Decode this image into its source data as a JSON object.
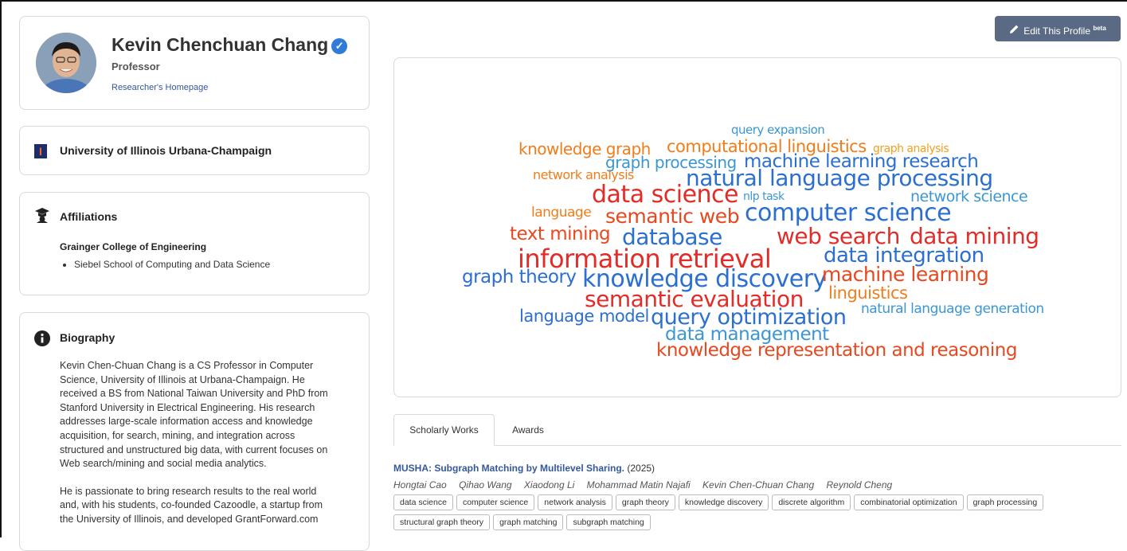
{
  "profile": {
    "name": "Kevin Chenchuan Chang",
    "title": "Professor",
    "homepage_link": "Researcher's Homepage"
  },
  "university": {
    "name": "University of Illinois Urbana-Champaign",
    "logo_letter": "I"
  },
  "affiliations": {
    "heading": "Affiliations",
    "college": "Grainger College of Engineering",
    "departments": [
      "Siebel School of Computing and Data Science"
    ]
  },
  "biography": {
    "heading": "Biography",
    "paragraphs": [
      "Kevin Chen-Chuan Chang is a CS Professor in Computer Science, University of Illinois at Urbana-Champaign. He received a BS from National Taiwan University and PhD from Stanford University in Electrical Engineering. His research addresses large-scale information access and knowledge acquisition, for search, mining, and integration across structured and unstructured big data, with current focuses on Web search/mining and social media analytics.",
      "He is passionate to bring research results to the real world and, with his students, co-founded Cazoodle, a startup from the University of Illinois, and developed GrantForward.com"
    ]
  },
  "edit_button": {
    "label": "Edit This Profile",
    "badge": "beta"
  },
  "word_cloud": [
    {
      "text": "query expansion",
      "color": "#3a97d4"
    },
    {
      "text": "knowledge graph",
      "color": "#f07d1a"
    },
    {
      "text": "computational linguistics",
      "color": "#f07d1a"
    },
    {
      "text": "graph analysis",
      "color": "#f0a020"
    },
    {
      "text": "graph processing",
      "color": "#3a97d4"
    },
    {
      "text": "machine learning research",
      "color": "#2b6fd0"
    },
    {
      "text": "network analysis",
      "color": "#f07d1a"
    },
    {
      "text": "natural language processing",
      "color": "#2b6fd0"
    },
    {
      "text": "data science",
      "color": "#e32b27"
    },
    {
      "text": "nlp task",
      "color": "#3a97d4"
    },
    {
      "text": "network science",
      "color": "#3a97d4"
    },
    {
      "text": "language",
      "color": "#f07d1a"
    },
    {
      "text": "semantic web",
      "color": "#e8481f"
    },
    {
      "text": "computer science",
      "color": "#2b6fd0"
    },
    {
      "text": "text mining",
      "color": "#e8481f"
    },
    {
      "text": "database",
      "color": "#2b6fd0"
    },
    {
      "text": "web search",
      "color": "#e32b27"
    },
    {
      "text": "data mining",
      "color": "#e32b27"
    },
    {
      "text": "information retrieval",
      "color": "#e32b27"
    },
    {
      "text": "data integration",
      "color": "#2b6fd0"
    },
    {
      "text": "graph theory",
      "color": "#2b6fd0"
    },
    {
      "text": "knowledge discovery",
      "color": "#2b6fd0"
    },
    {
      "text": "machine learning",
      "color": "#e8481f"
    },
    {
      "text": "semantic evaluation",
      "color": "#e32b27"
    },
    {
      "text": "linguistics",
      "color": "#f07d1a"
    },
    {
      "text": "natural language generation",
      "color": "#3a97d4"
    },
    {
      "text": "language model",
      "color": "#2b6fd0"
    },
    {
      "text": "query optimization",
      "color": "#2b6fd0"
    },
    {
      "text": "data management",
      "color": "#3a97d4"
    },
    {
      "text": "knowledge representation and reasoning",
      "color": "#e8481f"
    }
  ],
  "tabs": [
    "Scholarly Works",
    "Awards"
  ],
  "publication": {
    "title": "MUSHA: Subgraph Matching by Multilevel Sharing.",
    "year": "(2025)",
    "authors": [
      "Hongtai Cao",
      "Qihao Wang",
      "Xiaodong Li",
      "Mohammad Matin Najafi",
      "Kevin Chen-Chuan Chang",
      "Reynold Cheng"
    ],
    "tags": [
      "data science",
      "computer science",
      "network analysis",
      "graph theory",
      "knowledge discovery",
      "discrete algorithm",
      "combinatorial optimization",
      "graph processing",
      "structural graph theory",
      "graph matching",
      "subgraph matching"
    ]
  }
}
